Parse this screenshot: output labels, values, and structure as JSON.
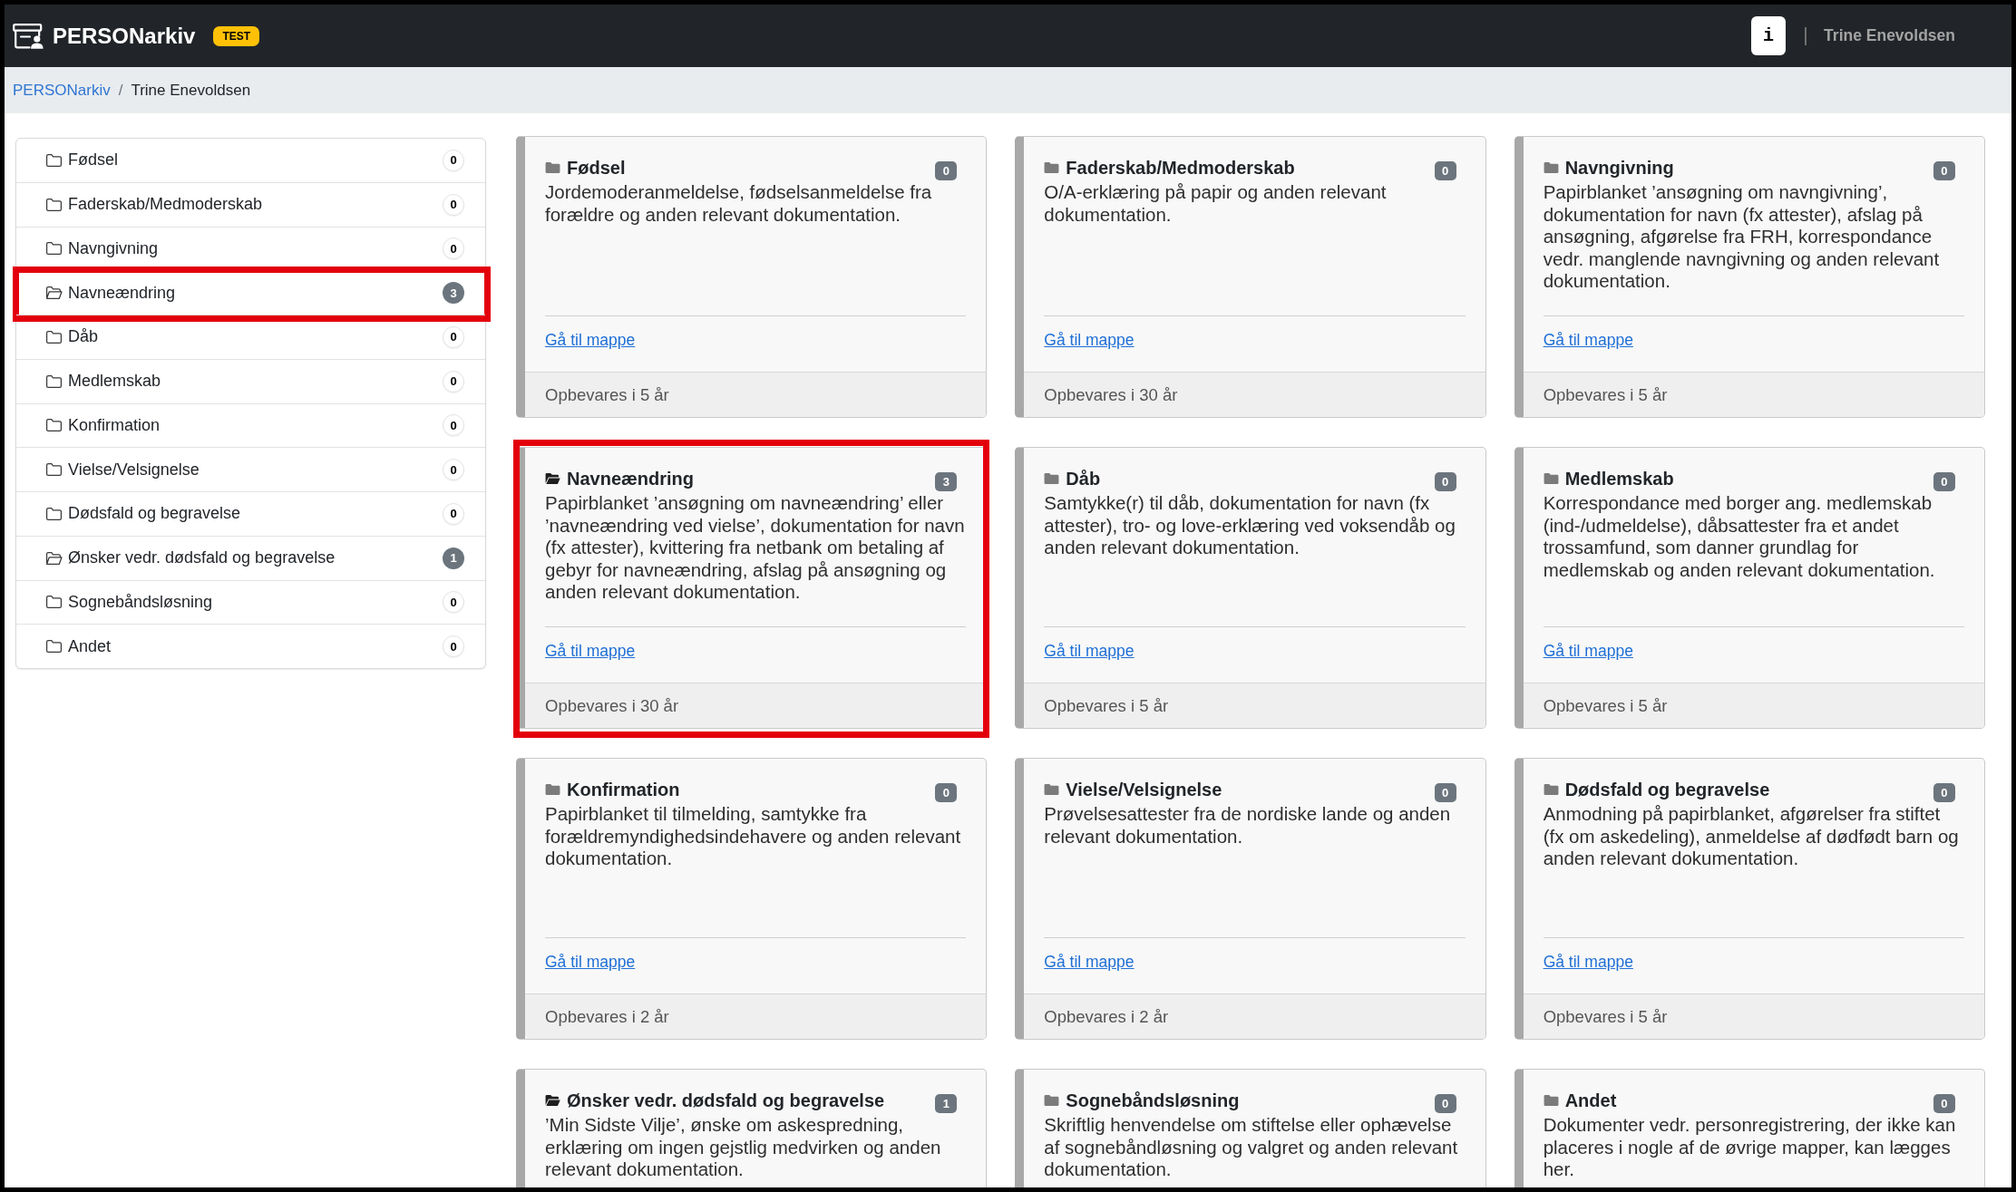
{
  "navbar": {
    "brand": "PERSONarkiv",
    "badge": "TEST",
    "info_button": "i",
    "user": "Trine Enevoldsen"
  },
  "breadcrumb": {
    "separator": "/",
    "items": [
      {
        "label": "PERSONarkiv",
        "kind": "link"
      },
      {
        "label": "Trine Enevoldsen",
        "kind": "current"
      }
    ]
  },
  "sidebar": {
    "items": [
      {
        "label": "Fødsel",
        "count": "0",
        "has_files": false,
        "highlighted": false
      },
      {
        "label": "Faderskab/Medmoderskab",
        "count": "0",
        "has_files": false,
        "highlighted": false
      },
      {
        "label": "Navngivning",
        "count": "0",
        "has_files": false,
        "highlighted": false
      },
      {
        "label": "Navneændring",
        "count": "3",
        "has_files": true,
        "highlighted": true
      },
      {
        "label": "Dåb",
        "count": "0",
        "has_files": false,
        "highlighted": false
      },
      {
        "label": "Medlemskab",
        "count": "0",
        "has_files": false,
        "highlighted": false
      },
      {
        "label": "Konfirmation",
        "count": "0",
        "has_files": false,
        "highlighted": false
      },
      {
        "label": "Vielse/Velsignelse",
        "count": "0",
        "has_files": false,
        "highlighted": false
      },
      {
        "label": "Dødsfald og begravelse",
        "count": "0",
        "has_files": false,
        "highlighted": false
      },
      {
        "label": "Ønsker vedr. dødsfald og begravelse",
        "count": "1",
        "has_files": true,
        "highlighted": false
      },
      {
        "label": "Sognebåndsløsning",
        "count": "0",
        "has_files": false,
        "highlighted": false
      },
      {
        "label": "Andet",
        "count": "0",
        "has_files": false,
        "highlighted": false
      }
    ]
  },
  "cards": [
    {
      "title": "Fødsel",
      "count": "0",
      "has_files": false,
      "highlighted": false,
      "description": "Jordemoderanmeldelse, fødselsanmeldelse fra forældre og anden relevant dokumentation.",
      "link": "Gå til mappe",
      "footer": "Opbevares i 5 år"
    },
    {
      "title": "Faderskab/Medmoderskab",
      "count": "0",
      "has_files": false,
      "highlighted": false,
      "description": "O/A-erklæring på papir og anden relevant dokumentation.",
      "link": "Gå til mappe",
      "footer": "Opbevares i 30 år"
    },
    {
      "title": "Navngivning",
      "count": "0",
      "has_files": false,
      "highlighted": false,
      "description": "Papirblanket ’ansøgning om navngivning’, dokumentation for navn (fx attester), afslag på ansøgning, afgørelse fra FRH, korrespondance vedr. manglende navngivning og anden relevant dokumentation.",
      "link": "Gå til mappe",
      "footer": "Opbevares i 5 år"
    },
    {
      "title": "Navneændring",
      "count": "3",
      "has_files": true,
      "highlighted": true,
      "description": "Papirblanket ’ansøgning om navneændring’ eller ’navneændring ved vielse’, dokumentation for navn (fx attester), kvittering fra netbank om betaling af gebyr for navneændring, afslag på ansøgning og anden relevant dokumentation.",
      "link": "Gå til mappe",
      "footer": "Opbevares i 30 år"
    },
    {
      "title": "Dåb",
      "count": "0",
      "has_files": false,
      "highlighted": false,
      "description": "Samtykke(r) til dåb, dokumentation for navn (fx attester), tro- og love-erklæring ved voksendåb og anden relevant dokumentation.",
      "link": "Gå til mappe",
      "footer": "Opbevares i 5 år"
    },
    {
      "title": "Medlemskab",
      "count": "0",
      "has_files": false,
      "highlighted": false,
      "description": "Korrespondance med borger ang. medlemskab (ind-/udmeldelse), dåbsattester fra et andet trossamfund, som danner grundlag for medlemskab og anden relevant dokumentation.",
      "link": "Gå til mappe",
      "footer": "Opbevares i 5 år"
    },
    {
      "title": "Konfirmation",
      "count": "0",
      "has_files": false,
      "highlighted": false,
      "description": "Papirblanket til tilmelding, samtykke fra forældremyndighedsindehavere og anden relevant dokumentation.",
      "link": "Gå til mappe",
      "footer": "Opbevares i 2 år"
    },
    {
      "title": "Vielse/Velsignelse",
      "count": "0",
      "has_files": false,
      "highlighted": false,
      "description": "Prøvelsesattester fra de nordiske lande og anden relevant dokumentation.",
      "link": "Gå til mappe",
      "footer": "Opbevares i 2 år"
    },
    {
      "title": "Dødsfald og begravelse",
      "count": "0",
      "has_files": false,
      "highlighted": false,
      "description": "Anmodning på papirblanket, afgørelser fra stiftet (fx om askedeling), anmeldelse af dødfødt barn og anden relevant dokumentation.",
      "link": "Gå til mappe",
      "footer": "Opbevares i 5 år"
    },
    {
      "title": "Ønsker vedr. dødsfald og begravelse",
      "count": "1",
      "has_files": true,
      "highlighted": false,
      "description": "’Min Sidste Vilje’, ønske om askespredning, erklæring om ingen gejstlig medvirken og anden relevant dokumentation."
    },
    {
      "title": "Sognebåndsløsning",
      "count": "0",
      "has_files": false,
      "highlighted": false,
      "description": "Skriftlig henvendelse om stiftelse eller ophævelse af sognebåndløsning og valgret og anden relevant dokumentation."
    },
    {
      "title": "Andet",
      "count": "0",
      "has_files": false,
      "highlighted": false,
      "description": "Dokumenter vedr. personregistrering, der ikke kan placeres i nogle af de øvrige mapper, kan lægges her."
    }
  ]
}
